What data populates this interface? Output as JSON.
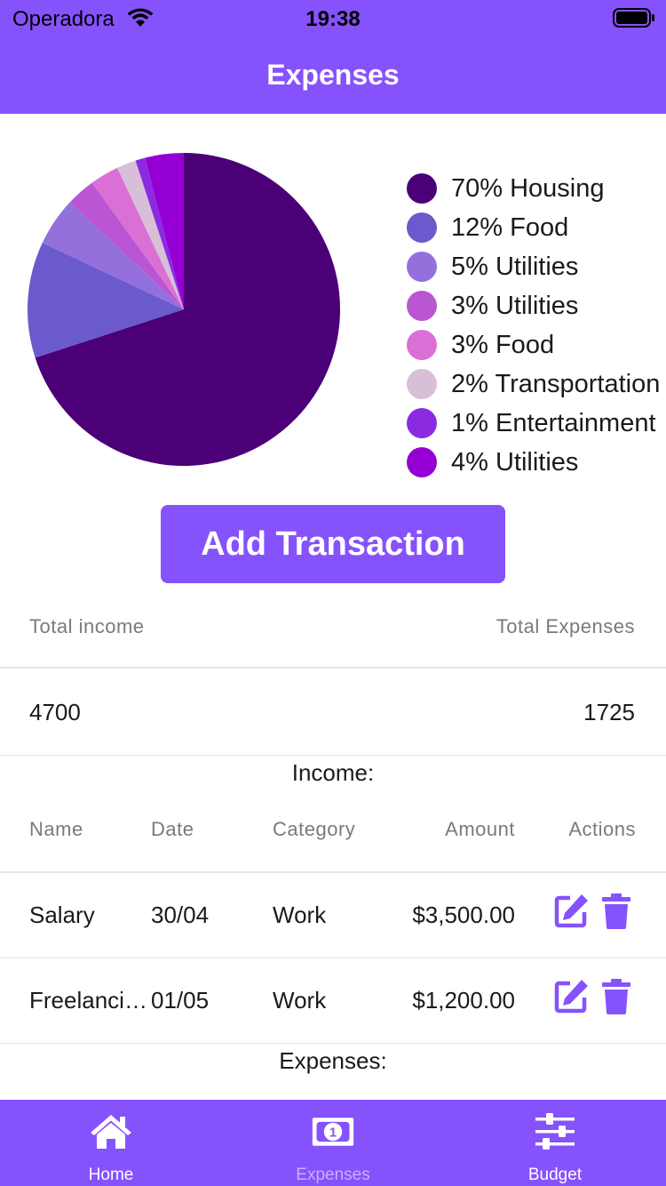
{
  "status": {
    "carrier": "Operadora",
    "time": "19:38"
  },
  "header": {
    "title": "Expenses"
  },
  "chart_data": {
    "type": "pie",
    "values": [
      70,
      12,
      5,
      3,
      3,
      2,
      1,
      4
    ],
    "labels": [
      "70% Housing",
      "12% Food",
      "5% Utilities",
      "3% Utilities",
      "3% Food",
      "2% Transportation",
      "1% Entertainment",
      "4% Utilities"
    ],
    "colors": [
      "#4b0077",
      "#6a5acd",
      "#9370db",
      "#ba55d3",
      "#da70d6",
      "#d8bfd8",
      "#8a2be2",
      "#9400d3"
    ],
    "legend_position": "right"
  },
  "legend_items": [
    {
      "label": "70% Housing",
      "color": "#4b0077"
    },
    {
      "label": "12% Food",
      "color": "#6a5acd"
    },
    {
      "label": "5% Utilities",
      "color": "#9370db"
    },
    {
      "label": "3% Utilities",
      "color": "#ba55d3"
    },
    {
      "label": "3% Food",
      "color": "#da70d6"
    },
    {
      "label": "2% Transportation",
      "color": "#d8bfd8"
    },
    {
      "label": "1% Entertainment",
      "color": "#8a2be2"
    },
    {
      "label": "4% Utilities",
      "color": "#9400d3"
    }
  ],
  "add_button": {
    "label": "Add Transaction"
  },
  "totals": {
    "income_label": "Total income",
    "expenses_label": "Total Expenses",
    "income_value": "4700",
    "expenses_value": "1725"
  },
  "income_section": {
    "title": "Income:"
  },
  "table": {
    "headers": [
      "Name",
      "Date",
      "Category",
      "Amount",
      "Actions"
    ],
    "rows": [
      {
        "name": "Salary",
        "date": "30/04",
        "category": "Work",
        "amount": "$3,500.00"
      },
      {
        "name": "Freelancing",
        "date": "01/05",
        "category": "Work",
        "amount": "$1,200.00"
      }
    ]
  },
  "expenses_section": {
    "title": "Expenses:"
  },
  "tabs": [
    {
      "label": "Home",
      "icon": "home-icon"
    },
    {
      "label": "Expenses",
      "icon": "money-icon"
    },
    {
      "label": "Budget",
      "icon": "sliders-icon"
    }
  ],
  "accent_color": "#8652fc",
  "active_tab_color": "#c9b0ff"
}
